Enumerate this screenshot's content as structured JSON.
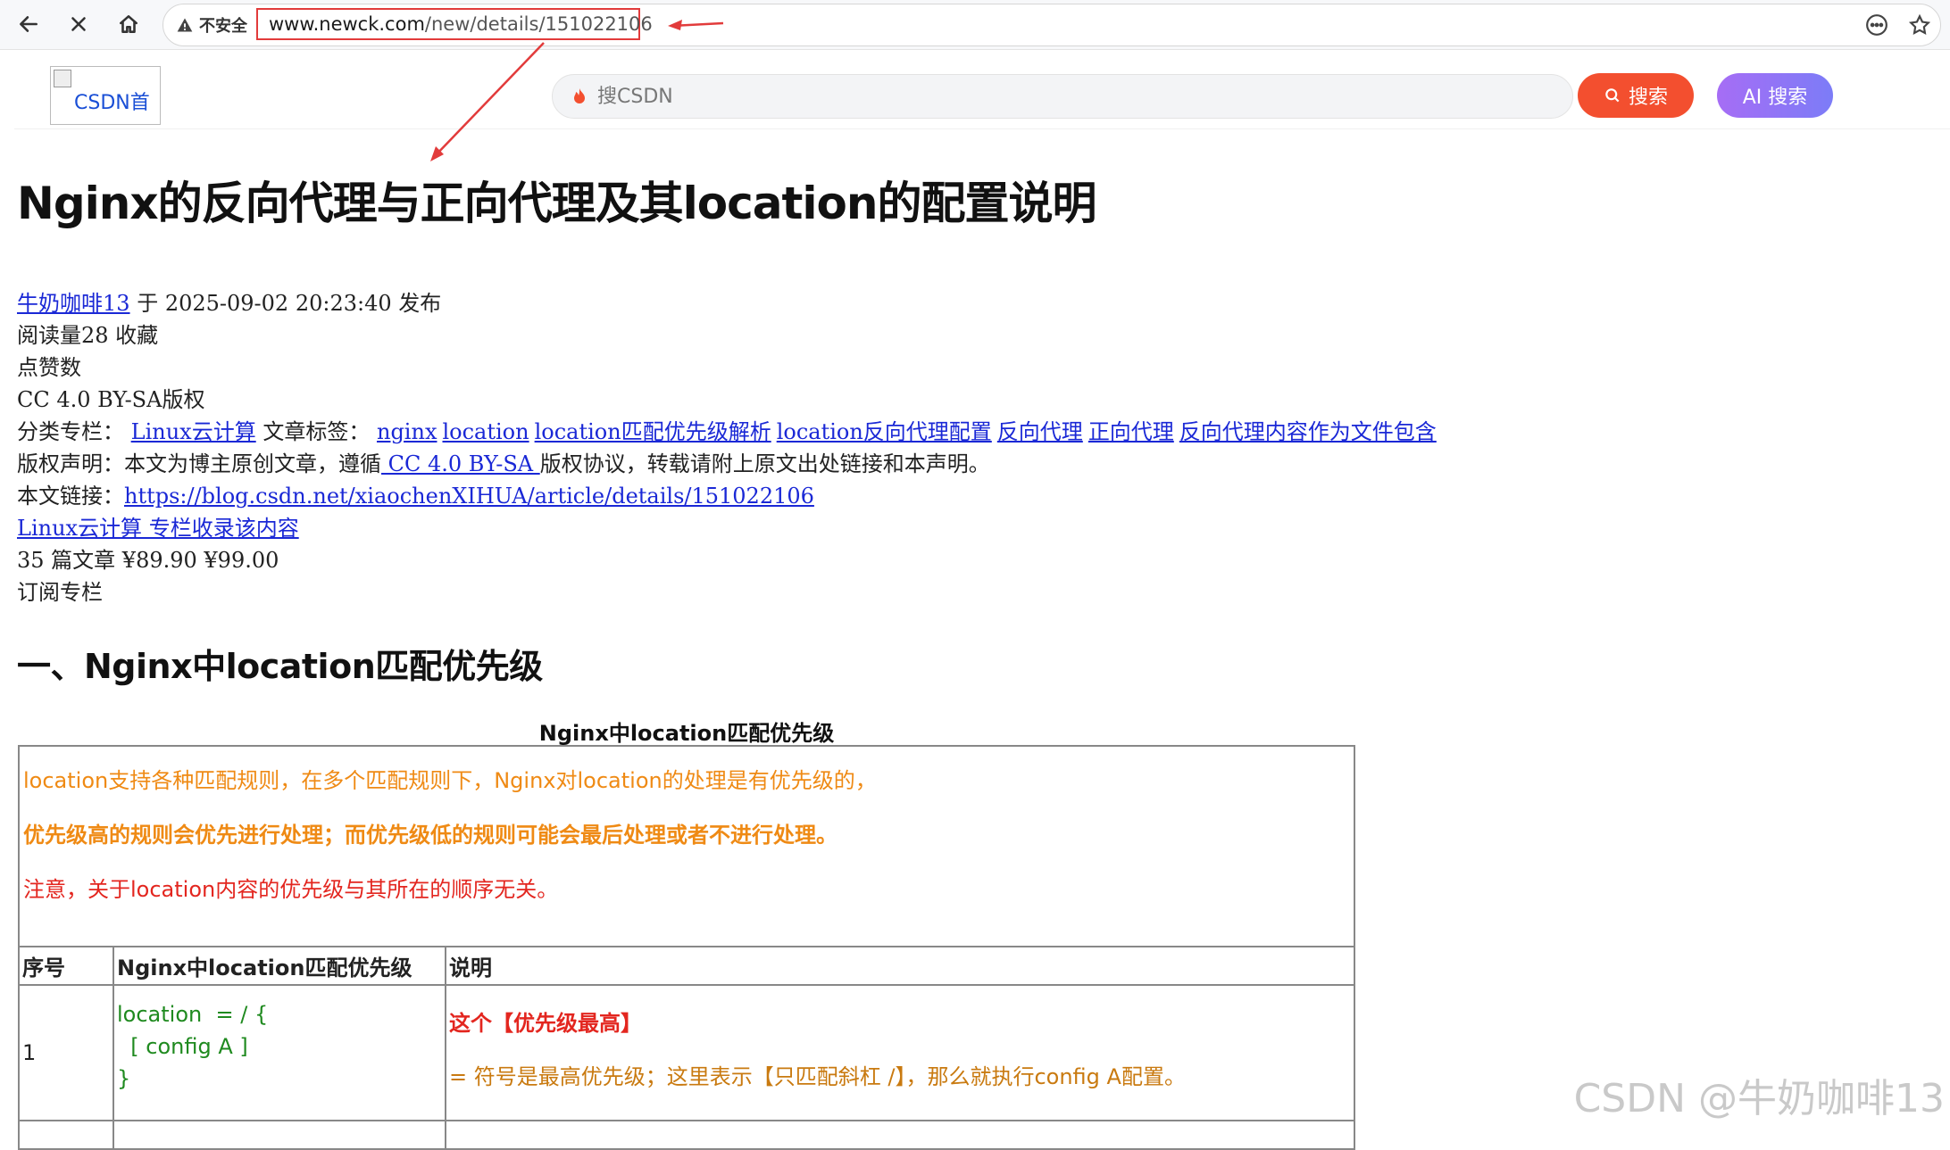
{
  "browser": {
    "security_label": "不安全",
    "url_host": "www.newck.com",
    "url_path": "/new/details/151022106",
    "icons": [
      "back-icon",
      "close-icon",
      "home-icon",
      "warning-icon",
      "more-icon",
      "star-icon"
    ]
  },
  "site_header": {
    "logo_alt": "CSDN首",
    "search_placeholder": "搜CSDN",
    "search_button": "搜索",
    "ai_search_button": "AI 搜索",
    "colors": {
      "search_button": "#f34f2f",
      "ai_button": "#8b75f6"
    }
  },
  "article": {
    "title": "Nginx的反向代理与正向代理及其location的配置说明",
    "author": "牛奶咖啡13",
    "published": "于 2025-09-02 20:23:40 发布",
    "reads": " 阅读量28  收藏",
    "likes": "点赞数",
    "license": "CC 4.0 BY-SA版权",
    "category_label": "分类专栏：",
    "category": "Linux云计算",
    "tags_label": "文章标签：",
    "tags": [
      "nginx",
      "location",
      "location匹配优先级解析",
      "location反向代理配置",
      "反向代理",
      "正向代理",
      "反向代理内容作为文件包含"
    ],
    "copyright_prefix": "版权声明：本文为博主原创文章，遵循",
    "copyright_link": " CC 4.0 BY-SA ",
    "copyright_suffix": "版权协议，转载请附上原文出处链接和本声明。",
    "link_label": "本文链接：",
    "link": "https://blog.csdn.net/xiaochenXIHUA/article/details/151022106",
    "column_link": " Linux云计算 专栏收录该内容",
    "column_stats": "35 篇文章 ¥89.90 ¥99.00",
    "subscribe": "订阅专栏"
  },
  "section": {
    "heading": "一、Nginx中location匹配优先级",
    "table_caption": "Nginx中location匹配优先级",
    "intro_line1": "location支持各种匹配规则，在多个匹配规则下，Nginx对location的处理是有优先级的，",
    "intro_line2": "优先级高的规则会优先进行处理；而优先级低的规则可能会最后处理或者不进行处理。",
    "intro_line3": "注意，关于location内容的优先级与其所在的顺序无关。",
    "columns": [
      "序号",
      "Nginx中location匹配优先级",
      "说明"
    ],
    "rows": [
      {
        "no": "1",
        "code1": "location  = / {",
        "code2": "  [ config A ]",
        "code3": "}",
        "highlight": "这个【优先级最高】",
        "desc": "= 符号是最高优先级；这里表示【只匹配斜杠 /】，那么就执行config A配置。"
      }
    ]
  },
  "watermark": "CSDN @牛奶咖啡13",
  "annotation_color": "#e23b3b"
}
